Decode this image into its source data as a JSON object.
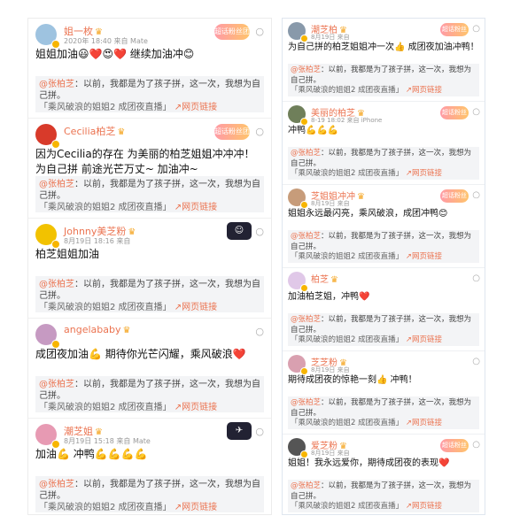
{
  "colors": {
    "link": "#eb7350",
    "badge_gradient_start": "#ff9aa6",
    "badge_gradient_end": "#ffc46b",
    "quote_bg": "#f3f4f6"
  },
  "shared": {
    "quote_user": "@张柏芝",
    "quote_body": "：以前，我都是为了孩子拼，这一次，我想为自己拼。",
    "quote_tail": "「乘风破浪的姐姐2 成团夜直播」",
    "view_link": "↗网页链接",
    "badge": "超话粉丝团",
    "follow_icon": "circle-outline-icon"
  },
  "left_posts": [
    {
      "username": "姐一枚",
      "time": "2020年 18:40 来自 Mate",
      "content": "姐姐加油😃❤️😍❤️ 继续加油冲😊",
      "avatar_color": "#9ec3e0",
      "avatar_icon": "user-avatar-icon"
    },
    {
      "username": "Cecilia柏芝",
      "time": "",
      "content": "因为Cecilia的存在 为美丽的柏芝姐姐冲冲冲！为自己拼 前途光芒万丈~ 加油冲~",
      "avatar_color": "#d83a2a",
      "avatar_icon": "user-avatar-icon"
    },
    {
      "username": "Johnny美芝粉",
      "time": "8月19日 18:16 来自",
      "content": "柏芝姐姐加油",
      "avatar_color": "#f2c200",
      "avatar_icon": "user-avatar-icon"
    },
    {
      "username": "angelababy",
      "time": "",
      "content": "成团夜加油💪 期待你光芒闪耀，乘风破浪❤️",
      "avatar_color": "#c69ac2",
      "avatar_icon": "user-avatar-icon"
    },
    {
      "username": "潮芝姐",
      "time": "8月19日 15:18 来自 Mate",
      "content": "加油💪 冲鸭💪💪💪💪",
      "avatar_color": "#e79ab3",
      "avatar_icon": "user-avatar-icon"
    }
  ],
  "right_posts": [
    {
      "username": "潮芝柏",
      "time": "8月19日 来自",
      "content": "为自己拼的柏芝姐姐冲一次👍 成团夜加油冲鸭！",
      "avatar_color": "#8899aa",
      "avatar_icon": "user-avatar-icon"
    },
    {
      "username": "美丽的柏芝",
      "time": "8-19 18:02 来自 iPhone",
      "content": "冲鸭💪💪💪",
      "avatar_color": "#6f7f5a",
      "avatar_icon": "user-avatar-icon"
    },
    {
      "username": "芝姐姐冲冲",
      "time": "8月19日 来自",
      "content": "姐姐永远最闪亮，乘风破浪，成团冲鸭😊",
      "avatar_color": "#c79c7a",
      "avatar_icon": "user-avatar-icon"
    },
    {
      "username": "柏芝",
      "time": "",
      "content": "加油柏芝姐，冲鸭❤️",
      "avatar_color": "#e0c8e8",
      "avatar_icon": "user-avatar-icon"
    },
    {
      "username": "芝芝粉",
      "time": "8月19日 来自",
      "content": "期待成团夜的惊艳一刻👍 冲鸭！",
      "avatar_color": "#d9a0b0",
      "avatar_icon": "user-avatar-icon"
    },
    {
      "username": "爱芝粉",
      "time": "8月19日 来自",
      "content": "姐姐！我永远爱你，期待成团夜的表现❤️",
      "avatar_color": "#555555",
      "avatar_icon": "user-avatar-icon"
    }
  ]
}
